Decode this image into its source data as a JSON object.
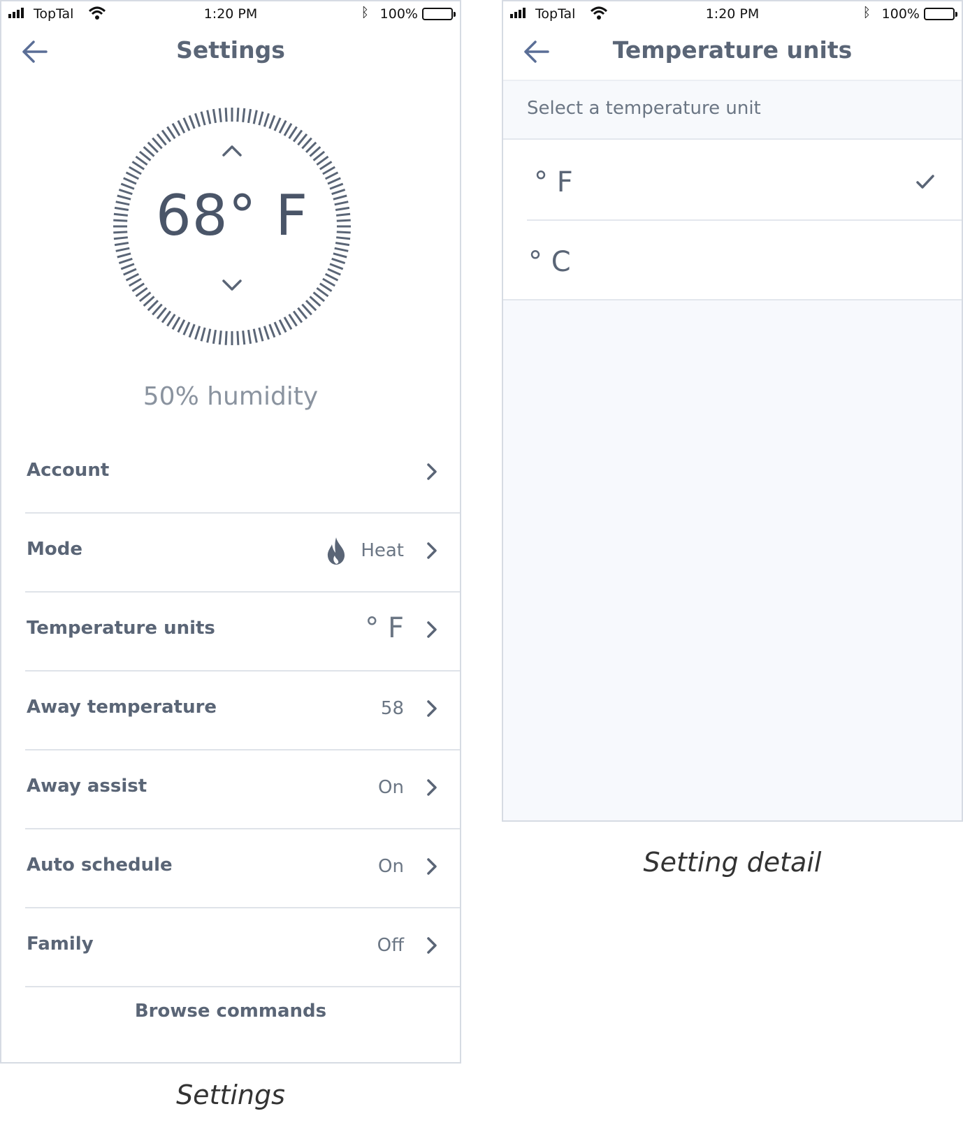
{
  "status_bar": {
    "carrier": "TopTal",
    "time": "1:20 PM",
    "battery": "100%"
  },
  "settings_screen": {
    "title": "Settings",
    "temperature": "68° F",
    "humidity": "50% humidity",
    "rows": [
      {
        "label": "Account",
        "value": ""
      },
      {
        "label": "Mode",
        "value": "Heat",
        "icon": "flame-icon"
      },
      {
        "label": "Temperature units",
        "value": "° F"
      },
      {
        "label": "Away temperature",
        "value": "58"
      },
      {
        "label": "Away assist",
        "value": "On"
      },
      {
        "label": "Auto schedule",
        "value": "On"
      },
      {
        "label": "Family",
        "value": "Off"
      }
    ],
    "browse_commands": "Browse commands",
    "caption": "Settings"
  },
  "detail_screen": {
    "title": "Temperature units",
    "section_header": "Select a temperature unit",
    "options": [
      {
        "label": "° F",
        "selected": true
      },
      {
        "label": "° C",
        "selected": false
      }
    ],
    "caption": "Setting detail"
  },
  "colors": {
    "accent": "#5a6e96",
    "text": "#5a6576",
    "divider": "#dfe3e9",
    "panel_bg": "#f7f9fd"
  }
}
